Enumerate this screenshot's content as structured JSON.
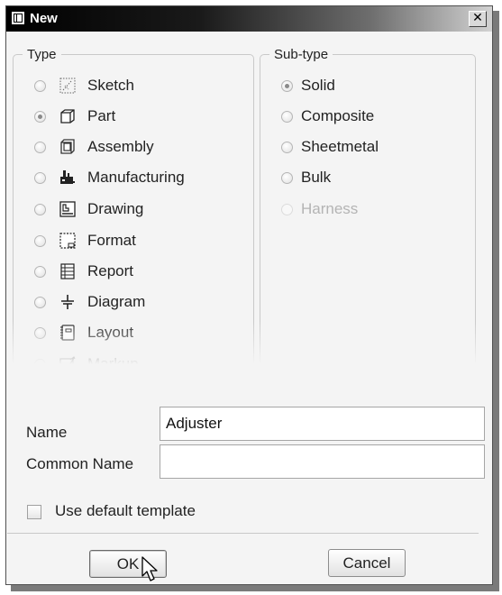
{
  "window": {
    "title": "New",
    "close_glyph": "✕"
  },
  "type_group": {
    "legend": "Type",
    "selected": "Part",
    "items": [
      {
        "label": "Sketch",
        "icon": "sketch-icon",
        "selected": false
      },
      {
        "label": "Part",
        "icon": "part-icon",
        "selected": true
      },
      {
        "label": "Assembly",
        "icon": "assembly-icon",
        "selected": false
      },
      {
        "label": "Manufacturing",
        "icon": "manufacturing-icon",
        "selected": false
      },
      {
        "label": "Drawing",
        "icon": "drawing-icon",
        "selected": false
      },
      {
        "label": "Format",
        "icon": "format-icon",
        "selected": false
      },
      {
        "label": "Report",
        "icon": "report-icon",
        "selected": false
      },
      {
        "label": "Diagram",
        "icon": "diagram-icon",
        "selected": false
      },
      {
        "label": "Layout",
        "icon": "layout-icon",
        "selected": false
      },
      {
        "label": "Markup",
        "icon": "markup-icon",
        "selected": false
      }
    ]
  },
  "subtype_group": {
    "legend": "Sub-type",
    "selected": "Solid",
    "items": [
      {
        "label": "Solid",
        "selected": true,
        "enabled": true
      },
      {
        "label": "Composite",
        "selected": false,
        "enabled": true
      },
      {
        "label": "Sheetmetal",
        "selected": false,
        "enabled": true
      },
      {
        "label": "Bulk",
        "selected": false,
        "enabled": true
      },
      {
        "label": "Harness",
        "selected": false,
        "enabled": false
      }
    ]
  },
  "fields": {
    "name_label": "Name",
    "name_value": "Adjuster",
    "common_name_label": "Common Name",
    "common_name_value": ""
  },
  "options": {
    "use_default_template_label": "Use default template",
    "use_default_template_checked": false
  },
  "buttons": {
    "ok": "OK",
    "cancel": "Cancel"
  }
}
